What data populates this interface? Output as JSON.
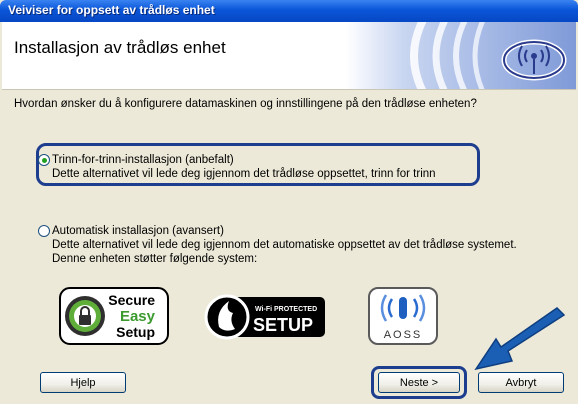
{
  "window": {
    "title": "Veiviser for oppsett av trådløs enhet"
  },
  "header": {
    "heading": "Installasjon av trådløs enhet"
  },
  "question": "Hvordan ønsker du å konfigurere datamaskinen og innstillingene på den trådløse enheten?",
  "options": [
    {
      "label": "Trinn-for-trinn-installasjon (anbefalt)",
      "selected": true,
      "description": [
        "Dette alternativet vil lede deg igjennom det trådløse oppsettet, trinn for trinn"
      ]
    },
    {
      "label": "Automatisk installasjon (avansert)",
      "selected": false,
      "description": [
        "Dette alternativet vil lede deg igjennom det automatiske oppsettet av det trådløse systemet.",
        "Denne enheten støtter følgende system:"
      ]
    }
  ],
  "logos": {
    "ses": [
      "Secure",
      "Easy",
      "Setup"
    ],
    "wps": {
      "top": "Wi-Fi PROTECTED",
      "bottom": "SETUP"
    },
    "aoss": "AOSS"
  },
  "buttons": {
    "help": "Hjelp",
    "next": "Neste >",
    "cancel": "Avbryt"
  },
  "colors": {
    "titlebar": "#0a56d8",
    "dialog": "#ece9d8",
    "highlight": "#1d3e8f",
    "arrow": "#1a5fb4"
  }
}
